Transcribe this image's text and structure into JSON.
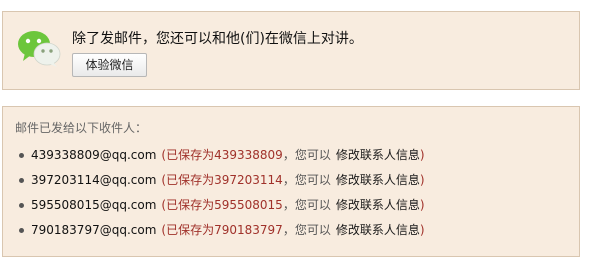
{
  "notice": {
    "text": "除了发邮件，您还可以和他(们)在微信上对讲。",
    "button_label": "体验微信"
  },
  "recipients": {
    "title": "邮件已发给以下收件人：",
    "items": [
      {
        "email": "439338809@qq.com",
        "saved_prefix": "已保存为",
        "saved_name": "439338809",
        "can_you": "，您可以",
        "edit_label": "修改联系人信息"
      },
      {
        "email": "397203114@qq.com",
        "saved_prefix": "已保存为",
        "saved_name": "397203114",
        "can_you": "，您可以",
        "edit_label": "修改联系人信息"
      },
      {
        "email": "595508015@qq.com",
        "saved_prefix": "已保存为",
        "saved_name": "595508015",
        "can_you": "，您可以",
        "edit_label": "修改联系人信息"
      },
      {
        "email": "790183797@qq.com",
        "saved_prefix": "已保存为",
        "saved_name": "790183797",
        "can_you": "，您可以",
        "edit_label": "修改联系人信息"
      }
    ]
  },
  "colors": {
    "panel_bg": "#f8ecdf",
    "panel_border": "#d9c6b0",
    "saved_red": "#a0312a",
    "wechat_green": "#6cc63c"
  },
  "icons": {
    "logo": "wechat-logo-icon"
  }
}
